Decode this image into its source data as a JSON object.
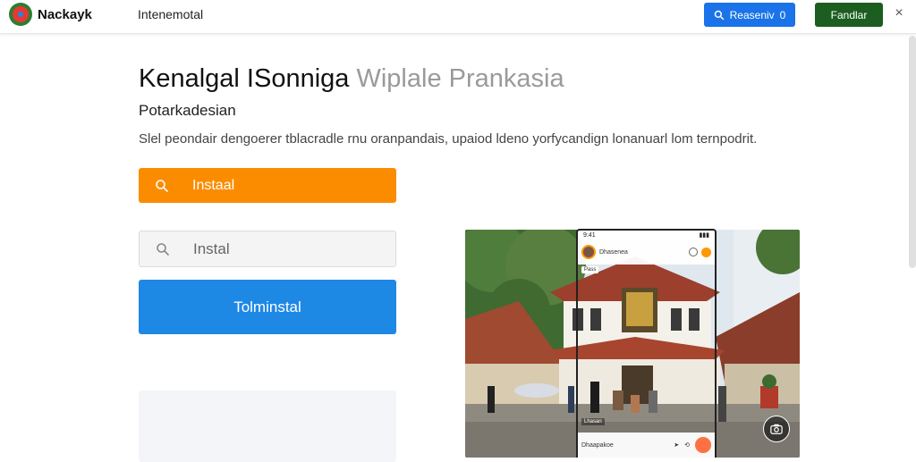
{
  "header": {
    "brand": "Nackayk",
    "subtitle": "Intenemotal",
    "search_button": "Reaseniv",
    "search_count": "0",
    "primary_button": "Fandlar",
    "close_label": "×"
  },
  "hero": {
    "title_dark": "Kenalgal ISonniga",
    "title_light": "Wiplale Prankasia",
    "subtitle": "Potarkadesian",
    "description": "Slel peondair dengoerer tblacradle rnu oranpandais, upaiod ldeno yorfycandign lonanuarl lom ternpodrit."
  },
  "actions": {
    "orange_button": "Instaal",
    "install_input_placeholder": "Instal",
    "blue_button": "Tolminstal"
  },
  "phone": {
    "time": "9:41",
    "profile_name": "Dhasenea",
    "badge": "Pass",
    "footer_text": "Dhaapakoe",
    "live_label": "Lhasan"
  },
  "colors": {
    "accent_blue": "#1a73e8",
    "accent_green": "#1b5e20",
    "orange": "#fb8c00",
    "blue_button": "#1e88e5"
  }
}
